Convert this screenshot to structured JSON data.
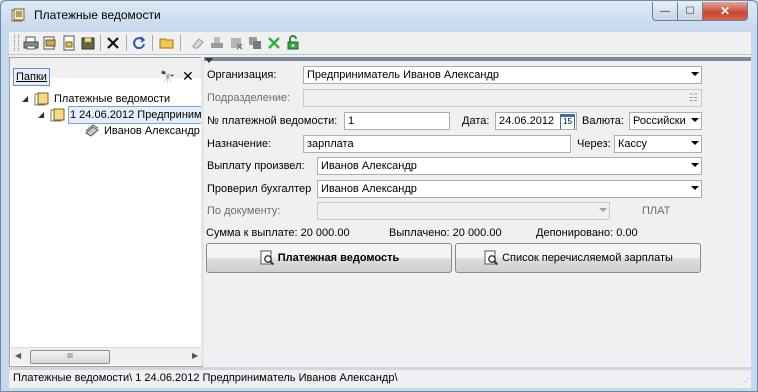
{
  "window": {
    "title": "Платежные ведомости"
  },
  "toolbar": {
    "icons": [
      "print-icon",
      "print-preview-icon",
      "export-icon",
      "save-icon",
      "delete-icon",
      "refresh-icon",
      "open-folder-icon",
      "eraser-icon",
      "stamp-icon",
      "delete-record-icon",
      "copy-icon",
      "cancel-icon",
      "unlock-icon"
    ]
  },
  "sidebar": {
    "tab_label": "Папки",
    "tree": {
      "root": "Платежные ведомости",
      "child": "1 24.06.2012 Предпринимате",
      "grandchild": "Иванов Александр"
    },
    "scroll_thumb": "III"
  },
  "form": {
    "org_label": "Организация:",
    "org_value": "Предприниматель Иванов Александр",
    "division_label": "Подразделение:",
    "division_value": "",
    "number_label": "№ платежной ведомости:",
    "number_value": "1",
    "date_label": "Дата:",
    "date_value": "24.06.2012",
    "calendar_day": "15",
    "currency_label": "Валюта:",
    "currency_value": "Российски",
    "purpose_label": "Назначение:",
    "purpose_value": "зарплата",
    "via_label": "Через:",
    "via_value": "Кассу",
    "paid_by_label": "Выплату произвел:",
    "paid_by_value": "Иванов Александр",
    "checked_by_label": "Проверил бухгалтер",
    "checked_by_value": "Иванов Александр",
    "document_label": "По документу:",
    "document_value": "",
    "doc_type": "ПЛАТ",
    "sum_to_pay": "Сумма к выплате: 20 000.00",
    "paid": "Выплачено: 20 000.00",
    "deposited": "Депонировано: 0.00"
  },
  "buttons": {
    "statement": "Платежная ведомость",
    "salary_list": "Список перечисляемой зарплаты"
  },
  "status": {
    "path": "Платежные ведомости\\ 1 24.06.2012 Предприниматель Иванов Александр\\"
  },
  "colors": {
    "accent": "#6b8fbf",
    "close_button": "#c8452f"
  }
}
